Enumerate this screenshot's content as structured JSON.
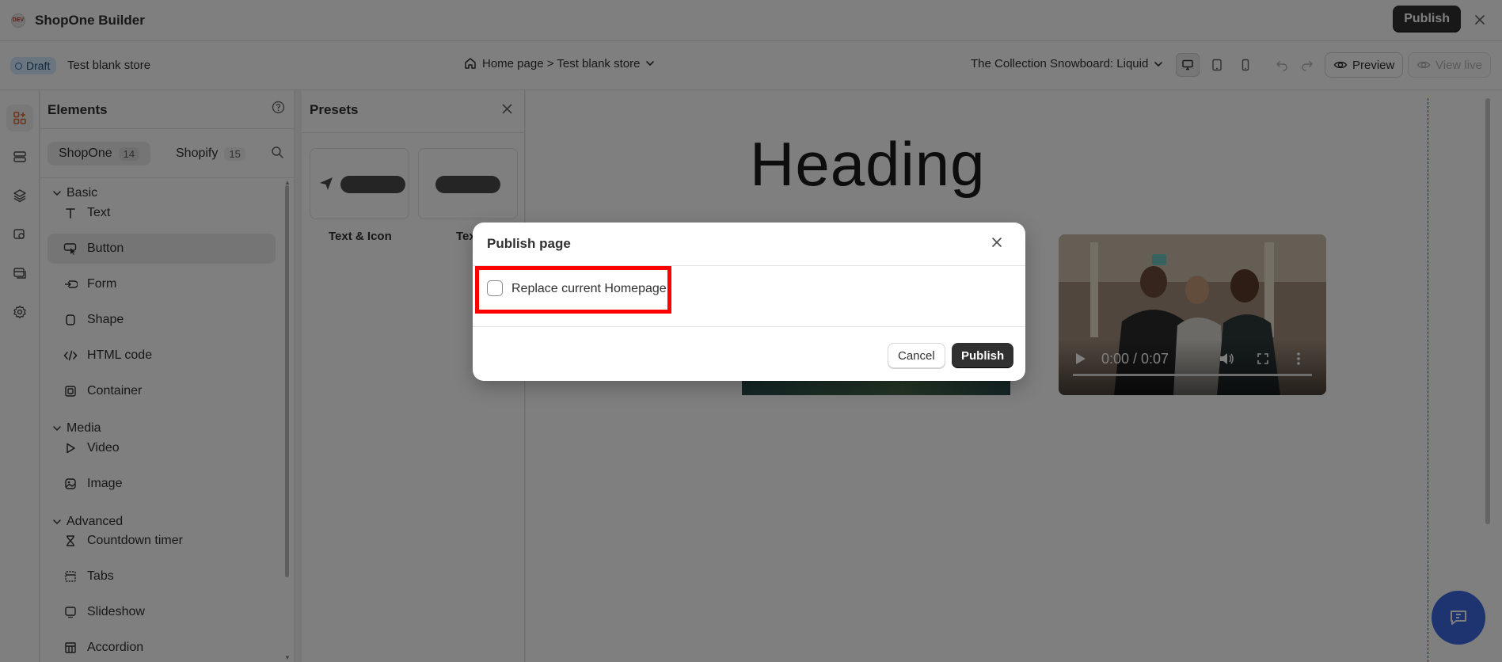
{
  "app": {
    "logo_text": "DEV",
    "title": "ShopOne Builder",
    "publish_label": "Publish"
  },
  "subbar": {
    "draft_label": "Draft",
    "store_name": "Test blank store",
    "breadcrumb": "Home page > Test blank store",
    "theme": "The Collection Snowboard: Liquid",
    "preview_label": "Preview",
    "view_live_label": "View live"
  },
  "elements_panel": {
    "title": "Elements",
    "tabs": [
      {
        "label": "ShopOne",
        "count": "14"
      },
      {
        "label": "Shopify",
        "count": "15"
      }
    ],
    "sections": [
      {
        "label": "Basic"
      },
      {
        "label": "Media"
      },
      {
        "label": "Advanced"
      }
    ],
    "items": [
      {
        "label": "Text",
        "icon": "text-icon"
      },
      {
        "label": "Button",
        "icon": "button-cursor-icon"
      },
      {
        "label": "Form",
        "icon": "form-icon"
      },
      {
        "label": "Shape",
        "icon": "shape-icon"
      },
      {
        "label": "HTML code",
        "icon": "code-icon"
      },
      {
        "label": "Container",
        "icon": "container-icon"
      },
      {
        "label": "Video",
        "icon": "play-icon"
      },
      {
        "label": "Image",
        "icon": "image-icon"
      },
      {
        "label": "Countdown timer",
        "icon": "hourglass-icon"
      },
      {
        "label": "Tabs",
        "icon": "tabs-icon"
      },
      {
        "label": "Slideshow",
        "icon": "slideshow-icon"
      },
      {
        "label": "Accordion",
        "icon": "accordion-icon"
      }
    ]
  },
  "presets_panel": {
    "title": "Presets",
    "cards": [
      {
        "label": "Text & Icon"
      },
      {
        "label": "Tex"
      }
    ]
  },
  "canvas": {
    "heading": "Heading",
    "video_time": "0:00 / 0:07"
  },
  "modal": {
    "title": "Publish page",
    "checkbox_label": "Replace current Homepage",
    "checkbox_checked": false,
    "cancel_label": "Cancel",
    "publish_label": "Publish"
  },
  "colors": {
    "primary_button": "#303030",
    "draft_badge_bg": "#d5ebff",
    "highlight": "#ff0000",
    "chat_button": "#3d68e2"
  }
}
